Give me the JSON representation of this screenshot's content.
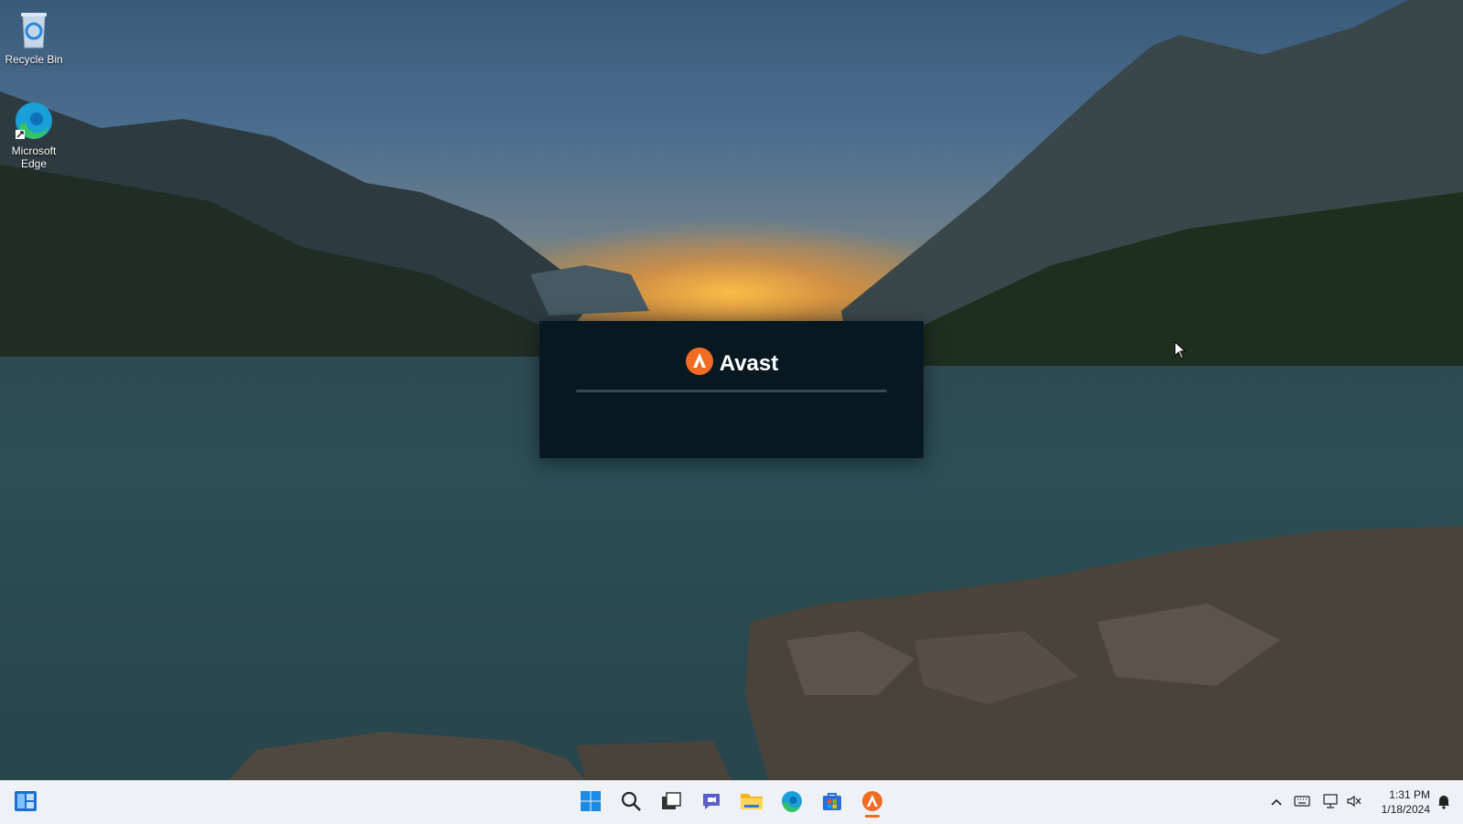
{
  "desktop": {
    "icons": [
      {
        "label": "Recycle Bin",
        "icon": "recycle-bin-icon"
      },
      {
        "label": "Microsoft\nEdge",
        "icon": "edge-icon"
      }
    ]
  },
  "splash": {
    "brand": "Avast",
    "logo_icon": "avast-logo-icon",
    "accent_color": "#f06c22",
    "background_color": "#071820",
    "progress_fraction": 0.0
  },
  "taskbar": {
    "left": [
      {
        "name": "widgets",
        "icon": "widgets-icon"
      }
    ],
    "center": [
      {
        "name": "start",
        "icon": "windows-start-icon"
      },
      {
        "name": "search",
        "icon": "search-icon"
      },
      {
        "name": "task-view",
        "icon": "task-view-icon"
      },
      {
        "name": "chat",
        "icon": "chat-icon"
      },
      {
        "name": "file-explorer",
        "icon": "folder-icon"
      },
      {
        "name": "edge",
        "icon": "edge-icon"
      },
      {
        "name": "store",
        "icon": "store-icon"
      },
      {
        "name": "avast",
        "icon": "avast-icon",
        "active": true
      }
    ],
    "tray": [
      {
        "name": "show-hidden",
        "icon": "chevron-up-icon"
      },
      {
        "name": "keyboard",
        "icon": "keyboard-icon"
      },
      {
        "name": "network",
        "icon": "network-icon"
      },
      {
        "name": "volume",
        "icon": "volume-icon"
      }
    ],
    "clock": {
      "time": "1:31 PM",
      "date": "1/18/2024"
    },
    "notifications_icon": "notification-bell-icon"
  }
}
